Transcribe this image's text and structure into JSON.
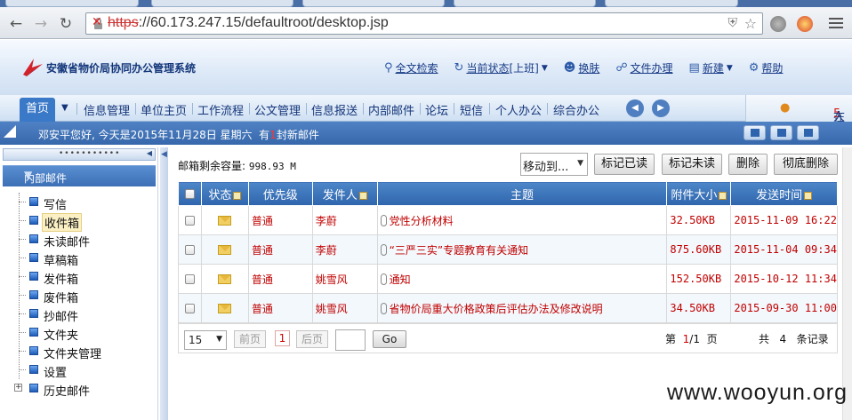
{
  "browser": {
    "url_scheme": "https",
    "url_rest": "://60.173.247.15/defaultroot/desktop.jsp"
  },
  "header": {
    "system_name": "安徽省物价局协同办公管理系统",
    "links": [
      {
        "icon": "magnifier-icon",
        "label": "全文检索"
      },
      {
        "icon": "status-icon",
        "label": "当前状态",
        "extra": "[上班]"
      },
      {
        "icon": "person-icon",
        "label": "换肤"
      },
      {
        "icon": "document-icon",
        "label": "文件办理"
      },
      {
        "icon": "new-doc-icon",
        "label": "新建"
      },
      {
        "icon": "gear-icon",
        "label": "帮助"
      }
    ]
  },
  "nav": {
    "home": "首页",
    "items": [
      "信息管理",
      "单位主页",
      "工作流程",
      "公文管理",
      "信息报送",
      "内部邮件",
      "论坛",
      "短信",
      "个人办公",
      "综合办公"
    ],
    "online_label": "在线",
    "online_count": "5",
    "online_unit": "人"
  },
  "welcome": {
    "greeting": "邓安平您好, 今天是2015年11月28日 星期六",
    "new_mail_prefix": "有",
    "new_mail_count": "1",
    "new_mail_suffix": "封新邮件"
  },
  "sidebar": {
    "title": "内部邮件",
    "items": [
      {
        "label": "写信"
      },
      {
        "label": "收件箱",
        "selected": true
      },
      {
        "label": "未读邮件"
      },
      {
        "label": "草稿箱"
      },
      {
        "label": "发件箱"
      },
      {
        "label": "废件箱"
      },
      {
        "label": "抄邮件"
      },
      {
        "label": "文件夹"
      },
      {
        "label": "文件夹管理"
      },
      {
        "label": "设置"
      },
      {
        "label": "历史邮件",
        "expandable": true
      }
    ]
  },
  "mailbox": {
    "quota_label": "邮箱剩余容量:",
    "quota_value": "998.93 M",
    "move_to": "移动到...",
    "buttons": [
      "标记已读",
      "标记未读",
      "删除",
      "彻底删除"
    ],
    "columns": [
      "状态",
      "优先级",
      "发件人",
      "主题",
      "附件大小",
      "发送时间"
    ],
    "rows": [
      {
        "priority": "普通",
        "sender": "李蔚",
        "subject": "党性分析材料",
        "size": "32.50KB",
        "time": "2015-11-09 16:22"
      },
      {
        "priority": "普通",
        "sender": "李蔚",
        "subject": "“三严三实”专题教育有关通知",
        "size": "875.60KB",
        "time": "2015-11-04 09:34"
      },
      {
        "priority": "普通",
        "sender": "姚雪风",
        "subject": "通知",
        "size": "152.50KB",
        "time": "2015-10-12 11:34"
      },
      {
        "priority": "普通",
        "sender": "姚雪风",
        "subject": "省物价局重大价格政策后评估办法及修改说明",
        "size": "34.50KB",
        "time": "2015-09-30 11:00"
      }
    ]
  },
  "pager": {
    "page_size": "15",
    "prev": "前页",
    "current": "1",
    "next": "后页",
    "go": "Go",
    "page_label_pre": "第",
    "page_current": "1",
    "page_sep": "/",
    "page_total": "1",
    "page_label_post": "页",
    "total_pre": "共",
    "total_count": "4",
    "total_post": "条记录"
  },
  "watermark": "www.wooyun.org",
  "colors": {
    "nav_blue": "#3a78c8",
    "header_blue": "#2e65ac",
    "row_text_red": "#c00000"
  }
}
